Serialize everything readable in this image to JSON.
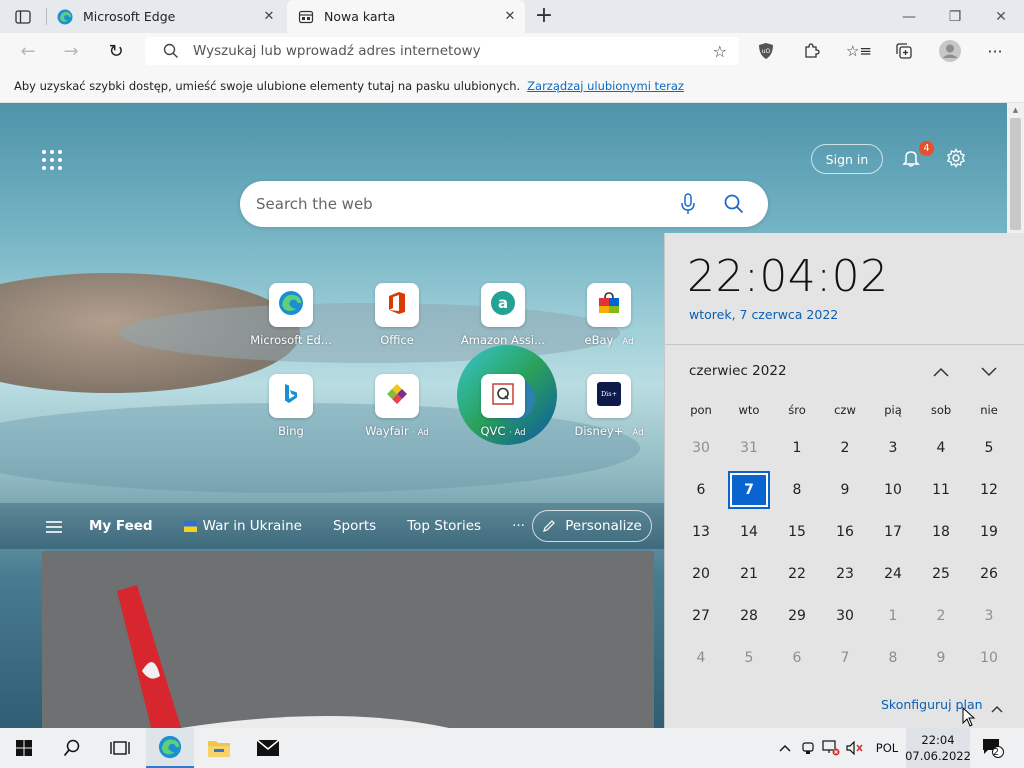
{
  "browser": {
    "tabs": [
      {
        "title": "Microsoft Edge"
      },
      {
        "title": "Nowa karta"
      }
    ],
    "address": {
      "placeholder": "Wyszukaj lub wprowadź adres internetowy"
    },
    "favorites_bar": {
      "message": "Aby uzyskać szybki dostęp, umieść swoje ulubione elementy tutaj na pasku ulubionych.",
      "link": "Zarządzaj ulubionymi teraz"
    }
  },
  "newtab": {
    "signin": "Sign in",
    "notification_count": "4",
    "search_placeholder": "Search the web",
    "tiles": [
      {
        "label": "Microsoft Ed...",
        "ad": "",
        "icon": "edge-icon"
      },
      {
        "label": "Office",
        "ad": "",
        "icon": "office-icon"
      },
      {
        "label": "Amazon Assi...",
        "ad": "",
        "icon": "amazon-icon"
      },
      {
        "label": "eBay",
        "ad": "· Ad",
        "icon": "ebay-icon"
      },
      {
        "label": "Bing",
        "ad": "",
        "icon": "bing-icon"
      },
      {
        "label": "Wayfair",
        "ad": "· Ad",
        "icon": "wayfair-icon"
      },
      {
        "label": "QVC",
        "ad": "· Ad",
        "icon": "qvc-icon"
      },
      {
        "label": "Disney+",
        "ad": "· Ad",
        "icon": "disney-icon"
      }
    ],
    "feed": {
      "my_feed": "My Feed",
      "war": "War in Ukraine",
      "sports": "Sports",
      "top_stories": "Top Stories",
      "more": "···",
      "personalize": "Personalize"
    }
  },
  "calendar": {
    "time": "22:04:02",
    "long_date": "wtorek, 7 czerwca 2022",
    "month_label": "czerwiec 2022",
    "weekdays": [
      "pon",
      "wto",
      "śro",
      "czw",
      "pią",
      "sob",
      "nie"
    ],
    "weeks": [
      [
        "30",
        "31",
        "1",
        "2",
        "3",
        "4",
        "5"
      ],
      [
        "6",
        "7",
        "8",
        "9",
        "10",
        "11",
        "12"
      ],
      [
        "13",
        "14",
        "15",
        "16",
        "17",
        "18",
        "19"
      ],
      [
        "20",
        "21",
        "22",
        "23",
        "24",
        "25",
        "26"
      ],
      [
        "27",
        "28",
        "29",
        "30",
        "1",
        "2",
        "3"
      ],
      [
        "4",
        "5",
        "6",
        "7",
        "8",
        "9",
        "10"
      ]
    ],
    "today": "7",
    "plan_link": "Skonfiguruj plan"
  },
  "taskbar": {
    "language": "POL",
    "time": "22:04",
    "date": "07.06.2022",
    "notification_count": "2"
  },
  "colors": {
    "accent": "#0a64d0",
    "link": "#0a5fb4",
    "badge": "#e5512a"
  }
}
